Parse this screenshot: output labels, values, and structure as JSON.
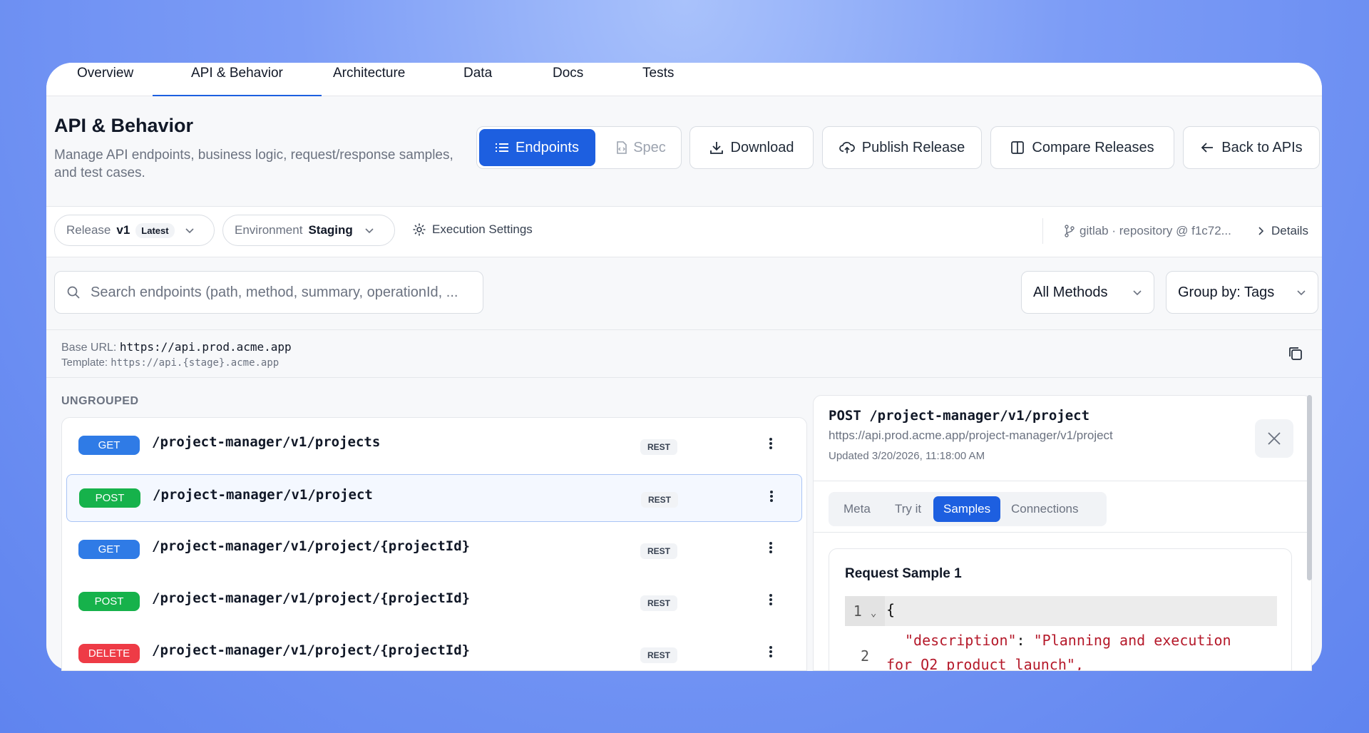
{
  "tabs": [
    {
      "label": "Overview"
    },
    {
      "label": "API & Behavior"
    },
    {
      "label": "Architecture"
    },
    {
      "label": "Data"
    },
    {
      "label": "Docs"
    },
    {
      "label": "Tests"
    }
  ],
  "header": {
    "title": "API & Behavior",
    "description": "Manage API endpoints, business logic, request/response samples, and test cases.",
    "view_toggle": {
      "endpoints": "Endpoints",
      "spec": "Spec"
    },
    "download": "Download",
    "publish": "Publish Release",
    "compare": "Compare Releases",
    "back": "Back to APIs"
  },
  "filters": {
    "release_label": "Release",
    "release_value": "v1",
    "release_badge": "Latest",
    "env_label": "Environment",
    "env_value": "Staging",
    "execution_settings": "Execution Settings",
    "repo": "gitlab · repository @ f1c72...",
    "details": "Details"
  },
  "search": {
    "placeholder": "Search endpoints (path, method, summary, operationId, ...",
    "methods": "All Methods",
    "group_by": "Group by: Tags"
  },
  "base": {
    "label": "Base URL:",
    "url": "https://api.prod.acme.app",
    "template_label": "Template:",
    "template": "https://api.{stage}.acme.app"
  },
  "list": {
    "group": "UNGROUPED",
    "endpoints": [
      {
        "method": "GET",
        "path": "/project-manager/v1/projects",
        "type": "REST"
      },
      {
        "method": "POST",
        "path": "/project-manager/v1/project",
        "type": "REST"
      },
      {
        "method": "GET",
        "path": "/project-manager/v1/project/{projectId}",
        "type": "REST"
      },
      {
        "method": "POST",
        "path": "/project-manager/v1/project/{projectId}",
        "type": "REST"
      },
      {
        "method": "DELETE",
        "path": "/project-manager/v1/project/{projectId}",
        "type": "REST"
      }
    ]
  },
  "colors": {
    "GET": "#2f7be6",
    "POST": "#16b24b",
    "DELETE": "#ee3b46",
    "accent": "#1d5fe0"
  },
  "detail": {
    "title": "POST /project-manager/v1/project",
    "url": "https://api.prod.acme.app/project-manager/v1/project",
    "updated": "Updated 3/20/2026, 11:18:00 AM",
    "tabs": [
      "Meta",
      "Try it",
      "Samples",
      "Connections"
    ],
    "sample_title": "Request Sample 1",
    "code": {
      "l1_num": "1",
      "l1": "{",
      "l2_num": "2",
      "l2_key": "\"description\"",
      "l2_sep": ": ",
      "l2_val": "\"Planning and execution",
      "l2_cont": "for Q2 product launch\","
    }
  }
}
